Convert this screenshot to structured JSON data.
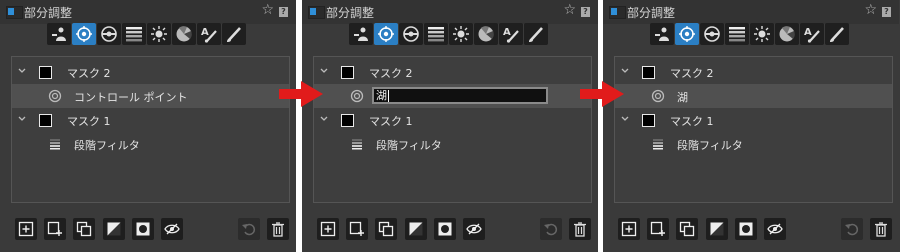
{
  "panels": [
    {
      "title": "部分調整",
      "masks": [
        {
          "name": "マスク 2",
          "item": "コントロール ポイント",
          "item_selected": true,
          "editing": false
        },
        {
          "name": "マスク 1",
          "item": "段階フィルタ"
        }
      ]
    },
    {
      "title": "部分調整",
      "masks": [
        {
          "name": "マスク 2",
          "item": "湖",
          "item_selected": true,
          "editing": true
        },
        {
          "name": "マスク 1",
          "item": "段階フィルタ"
        }
      ]
    },
    {
      "title": "部分調整",
      "masks": [
        {
          "name": "マスク 2",
          "item": "湖",
          "item_selected": true,
          "editing": false
        },
        {
          "name": "マスク 1",
          "item": "段階フィルタ"
        }
      ]
    }
  ],
  "toolbar_icons": [
    "adjust-person-icon",
    "control-point-icon",
    "circle-target-icon",
    "gradient-icon",
    "sun-icon",
    "fan-icon",
    "text-brush-icon",
    "brush-icon"
  ],
  "bottom_icons": [
    "add-icon",
    "add-sub-icon",
    "duplicate-icon",
    "half-square-icon",
    "circle-square-icon",
    "eye-off-icon",
    "undo-icon",
    "trash-icon"
  ],
  "accent_color": "#2b7fc4",
  "arrow_color": "#e11b1b"
}
